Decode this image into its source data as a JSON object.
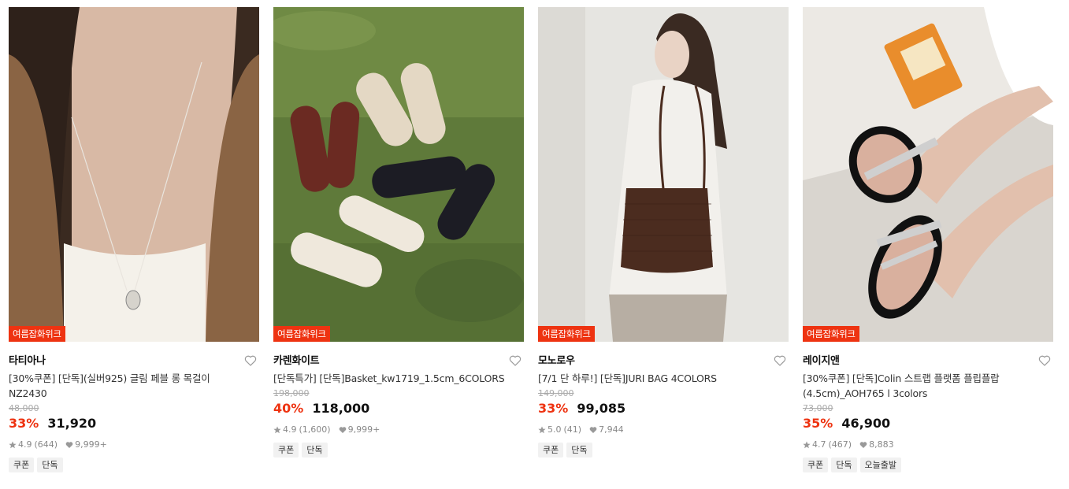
{
  "products": [
    {
      "promo_tag": "여름잡화위크",
      "brand": "타티아나",
      "name": "[30%쿠폰] [단독](실버925) 글림 페블 롱 목걸이 NZ2430",
      "original_price": "48,000",
      "discount_rate": "33%",
      "price": "31,920",
      "rating": "4.9",
      "review_count": "(644)",
      "likes": "9,999+",
      "tags": [
        "쿠폰",
        "단독"
      ]
    },
    {
      "promo_tag": "여름잡화위크",
      "brand": "카렌화이트",
      "name": "[단독특가] [단독]Basket_kw1719_1.5cm_6COLORS",
      "original_price": "198,000",
      "discount_rate": "40%",
      "price": "118,000",
      "rating": "4.9",
      "review_count": "(1,600)",
      "likes": "9,999+",
      "tags": [
        "쿠폰",
        "단독"
      ]
    },
    {
      "promo_tag": "여름잡화위크",
      "brand": "모노로우",
      "name": "[7/1 단 하루!] [단독]JURI BAG 4COLORS",
      "original_price": "149,000",
      "discount_rate": "33%",
      "price": "99,085",
      "rating": "5.0",
      "review_count": "(41)",
      "likes": "7,944",
      "tags": [
        "쿠폰",
        "단독"
      ]
    },
    {
      "promo_tag": "여름잡화위크",
      "brand": "레이지앤",
      "name": "[30%쿠폰] [단독]Colin 스트랩 플랫폼 플립플랍 (4.5cm)_AOH765 l 3colors",
      "original_price": "73,000",
      "discount_rate": "35%",
      "price": "46,900",
      "rating": "4.7",
      "review_count": "(467)",
      "likes": "8,883",
      "tags": [
        "쿠폰",
        "단독",
        "오늘출발"
      ]
    }
  ],
  "icons": {
    "like": "heart-outline-icon",
    "rating": "star-icon",
    "likes": "heart-icon"
  },
  "colors": {
    "accent": "#ee3311",
    "tag_bg": "#f1f1f1"
  }
}
